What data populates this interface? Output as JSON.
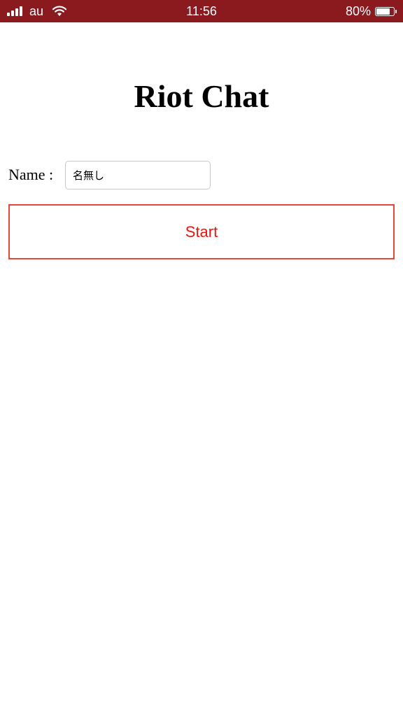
{
  "status_bar": {
    "carrier": "au",
    "time": "11:56",
    "battery_percent_label": "80%",
    "battery_level": 0.8,
    "background_color": "#8b1a1f",
    "signal_icon": "signal-bars-icon",
    "wifi_icon": "wifi-icon",
    "battery_icon": "battery-icon"
  },
  "app": {
    "title": "Riot Chat"
  },
  "form": {
    "name_label": "Name :",
    "name_value": "名無し",
    "start_label": "Start"
  },
  "colors": {
    "accent_red": "#e8453c",
    "start_text": "#e8160c"
  }
}
